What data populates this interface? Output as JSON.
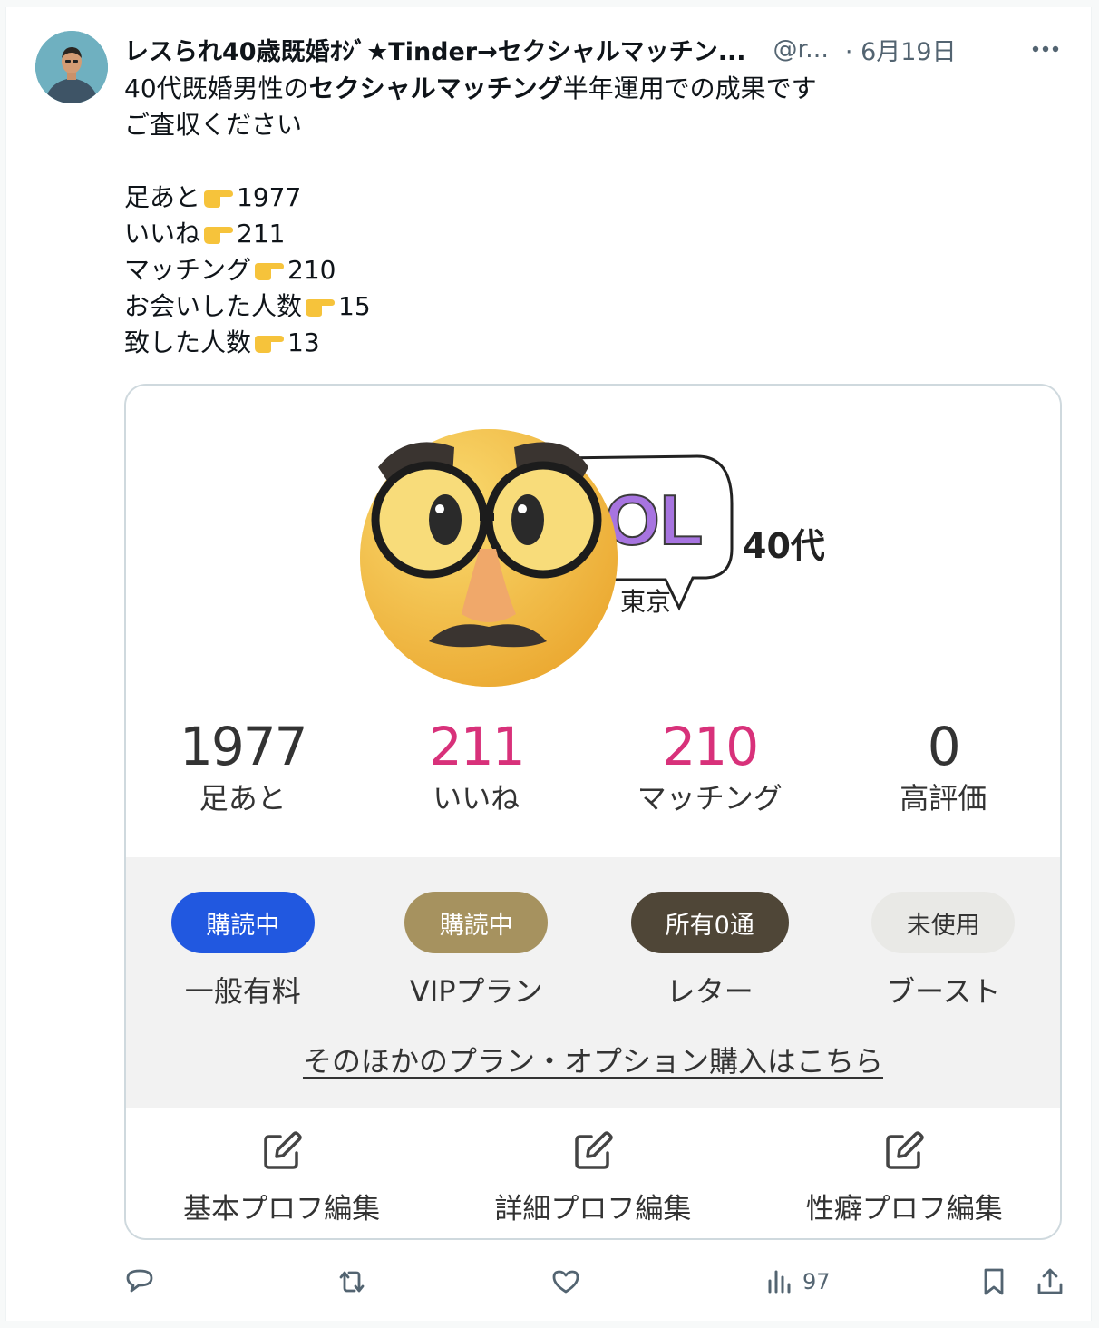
{
  "tweet": {
    "display_name": "レスられ40歳既婚ｵｼﾞ★Tinder→セクシャルマッチン...",
    "handle": "@r...",
    "date": "· 6月19日",
    "text": {
      "line1_pre": "40代既婚男性の",
      "line1_bold": "セクシャルマッチング",
      "line1_post": "半年運用での成果です",
      "line2": "ご査収ください",
      "stats": [
        {
          "label": "足あと",
          "value": "1977"
        },
        {
          "label": "いいね",
          "value": "211"
        },
        {
          "label": "マッチング",
          "value": "210"
        },
        {
          "label": "お会いした人数",
          "value": "15"
        },
        {
          "label": "致した人数",
          "value": "13"
        }
      ]
    }
  },
  "card": {
    "profile": {
      "badge_text": "OL",
      "age": "40代",
      "location": "東京"
    },
    "stats": [
      {
        "value": "1977",
        "label": "足あと",
        "color": "#333333"
      },
      {
        "value": "211",
        "label": "いいね",
        "color": "#d8317a"
      },
      {
        "value": "210",
        "label": "マッチング",
        "color": "#d8317a"
      },
      {
        "value": "0",
        "label": "高評価",
        "color": "#333333"
      }
    ],
    "plans": [
      {
        "status": "購読中",
        "label": "一般有料",
        "color": "#2158e0"
      },
      {
        "status": "購読中",
        "label": "VIPプラン",
        "color": "#a6925f"
      },
      {
        "status": "所有0通",
        "label": "レター",
        "color": "#4f4637"
      },
      {
        "status": "未使用",
        "label": "ブースト",
        "color": "#e9e9e6"
      }
    ],
    "other_link": "そのほかのプラン・オプション購入はこちら",
    "edits": [
      {
        "label": "基本プロフ編集",
        "icon": "edit-icon"
      },
      {
        "label": "詳細プロフ編集",
        "icon": "edit-icon"
      },
      {
        "label": "性癖プロフ編集",
        "icon": "edit-icon"
      }
    ]
  },
  "actions": {
    "reply": "reply-icon",
    "retweet": "retweet-icon",
    "like": "like-icon",
    "views_count": "97",
    "bookmark": "bookmark-icon",
    "share": "share-icon"
  }
}
